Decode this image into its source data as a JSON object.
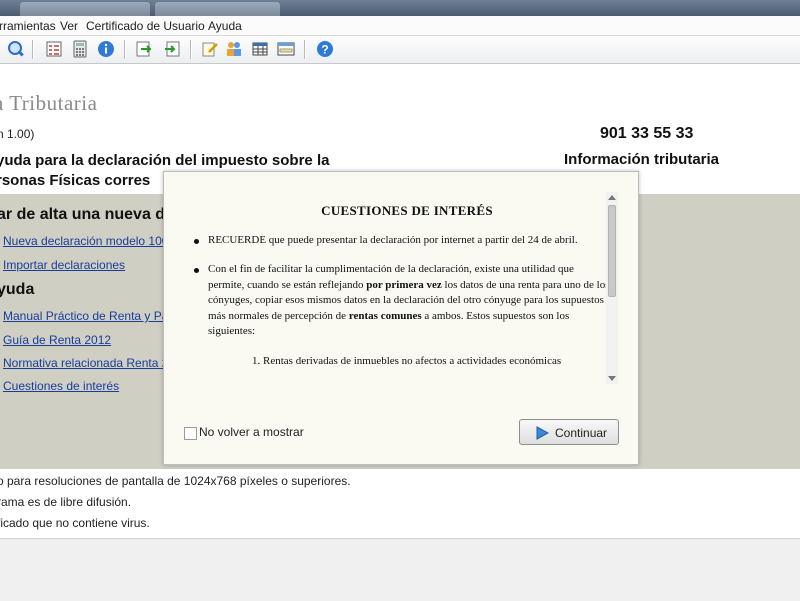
{
  "menu": {
    "items": [
      "rramientas",
      "Ver",
      "Certificado de Usuario",
      "Ayuda"
    ]
  },
  "toolbar": {
    "icons": [
      "search-icon",
      "checklist-icon",
      "calculator-icon",
      "info-icon",
      "import-icon",
      "export-icon",
      "edit-icon",
      "users-icon",
      "table-icon",
      "form-icon",
      "help-icon"
    ]
  },
  "header": {
    "brand": "a Tributaria",
    "version": "n  1.00)",
    "phone": "901 33 55 33",
    "info_label": "Información tributaria",
    "heading_line1": "yuda para la declaración del impuesto sobre la",
    "heading_line2": "rsonas Físicas corres"
  },
  "sections": {
    "alta": {
      "title": "ar de alta una nueva d",
      "links": [
        "Nueva declaración modelo 100",
        "Importar declaraciones"
      ]
    },
    "ayuda": {
      "title": "yuda",
      "links": [
        "Manual Práctico de Renta y Pa",
        "Guía de Renta 2012",
        "Normativa relacionada Renta 2",
        "Cuestiones de interés"
      ]
    }
  },
  "footer": {
    "lines": [
      "o para resoluciones de pantalla de 1024x768 píxeles o superiores.",
      "rama es de libre difusión.",
      "ficado que no contiene virus."
    ]
  },
  "dialog": {
    "title": "CUESTIONES DE INTERÉS",
    "para1": "RECUERDE que puede presentar la declaración por internet a partir del 24 de abril.",
    "para2_part1": "Con el fin de facilitar la cumplimentación de la declaración, existe una utilidad que permite, cuando se están reflejando ",
    "para2_bold1": "por primera vez",
    "para2_part2": " los datos de una renta para uno de los cónyuges, copiar esos mismos datos en la declaración del otro cónyuge para los supuestos más normales de percepción de ",
    "para2_bold2": "rentas comunes",
    "para2_part3": " a ambos. Estos supuestos son los siguientes:",
    "item1": "1.  Rentas derivadas de inmuebles no afectos a actividades económicas",
    "checkbox_label": "No volver a mostrar",
    "continue_label": "Continuar"
  }
}
